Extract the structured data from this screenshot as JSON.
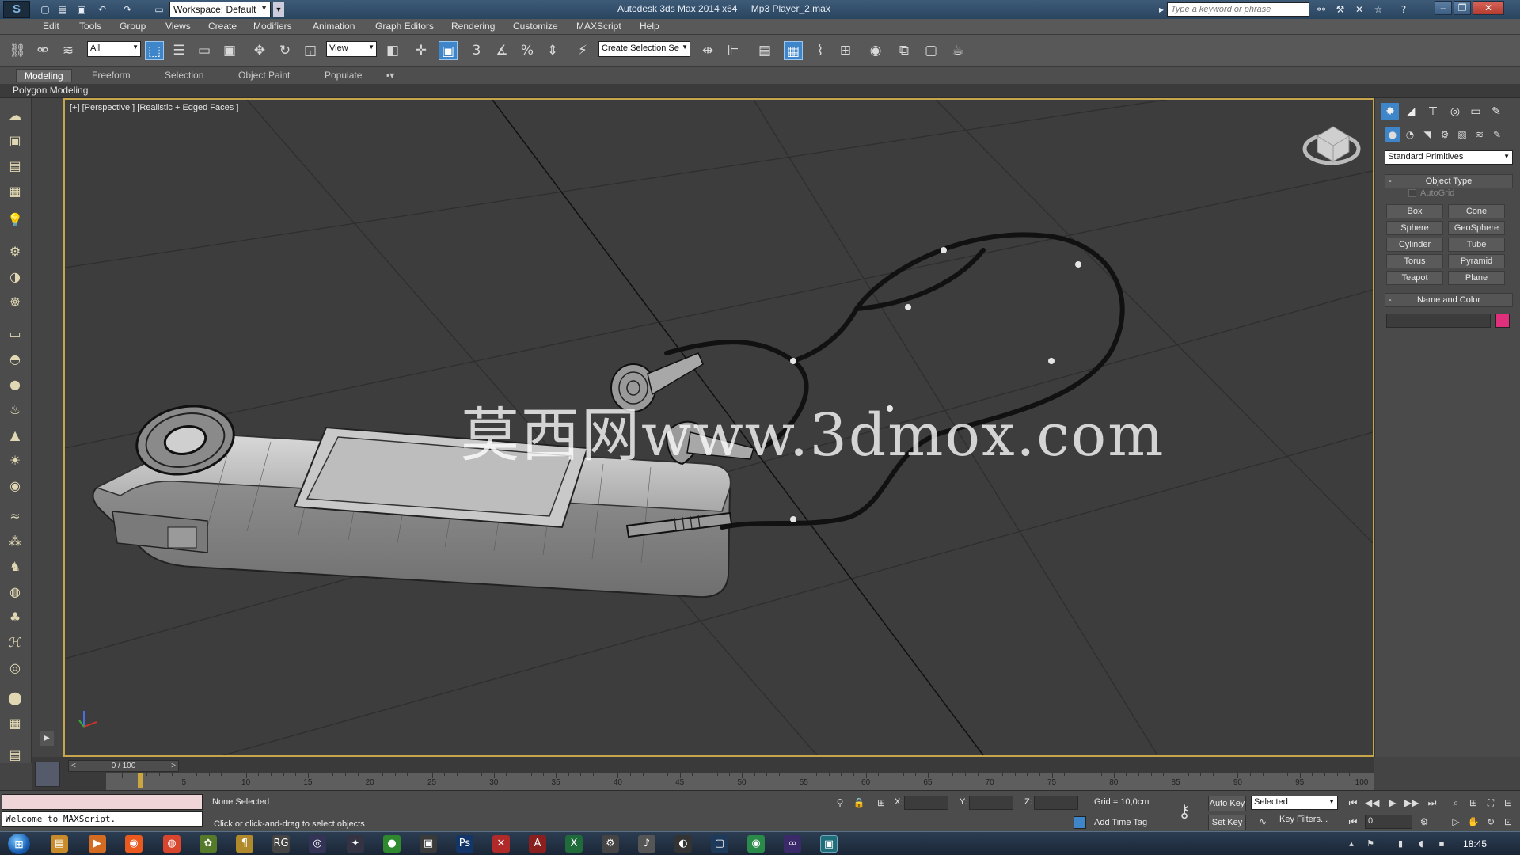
{
  "window": {
    "title": "Autodesk 3ds Max  2014 x64",
    "file": "Mp3 Player_2.max",
    "workspace": "Workspace: Default",
    "search_placeholder": "Type a keyword or phrase"
  },
  "menu": [
    "Edit",
    "Tools",
    "Group",
    "Views",
    "Create",
    "Modifiers",
    "Animation",
    "Graph Editors",
    "Rendering",
    "Customize",
    "MAXScript",
    "Help"
  ],
  "toolbar": {
    "filter": "All",
    "ref_coord": "View",
    "selection_set": "Create Selection Se"
  },
  "ribbon": {
    "tabs": [
      "Modeling",
      "Freeform",
      "Selection",
      "Object Paint",
      "Populate"
    ],
    "active_tab": "Modeling",
    "subpanel": "Polygon Modeling"
  },
  "viewport": {
    "label": "[+] [Perspective ] [Realistic + Edged Faces ]",
    "watermark": "莫西网www.3dmox.com"
  },
  "command_panel": {
    "dropdown": "Standard Primitives",
    "object_type_title": "Object Type",
    "autogrid": "AutoGrid",
    "primitives": [
      "Box",
      "Cone",
      "Sphere",
      "GeoSphere",
      "Cylinder",
      "Tube",
      "Torus",
      "Pyramid",
      "Teapot",
      "Plane"
    ],
    "name_color_title": "Name and Color",
    "object_color": "#e0307c"
  },
  "timeline": {
    "slider": "0 / 100",
    "ticks": [
      "5",
      "10",
      "15",
      "20",
      "25",
      "30",
      "35",
      "40",
      "45",
      "50",
      "55",
      "60",
      "65",
      "70",
      "75",
      "80",
      "85",
      "90",
      "95",
      "100"
    ]
  },
  "status": {
    "maxscript": "Welcome to MAXScript.",
    "selection": "None Selected",
    "prompt": "Click or click-and-drag to select objects",
    "x_label": "X:",
    "y_label": "Y:",
    "z_label": "Z:",
    "grid": "Grid = 10,0cm",
    "add_time_tag": "Add Time Tag",
    "auto_key": "Auto Key",
    "set_key": "Set Key",
    "key_mode": "Selected",
    "key_filters": "Key Filters...",
    "frame": "0"
  },
  "taskbar": {
    "clock": "18:45"
  }
}
